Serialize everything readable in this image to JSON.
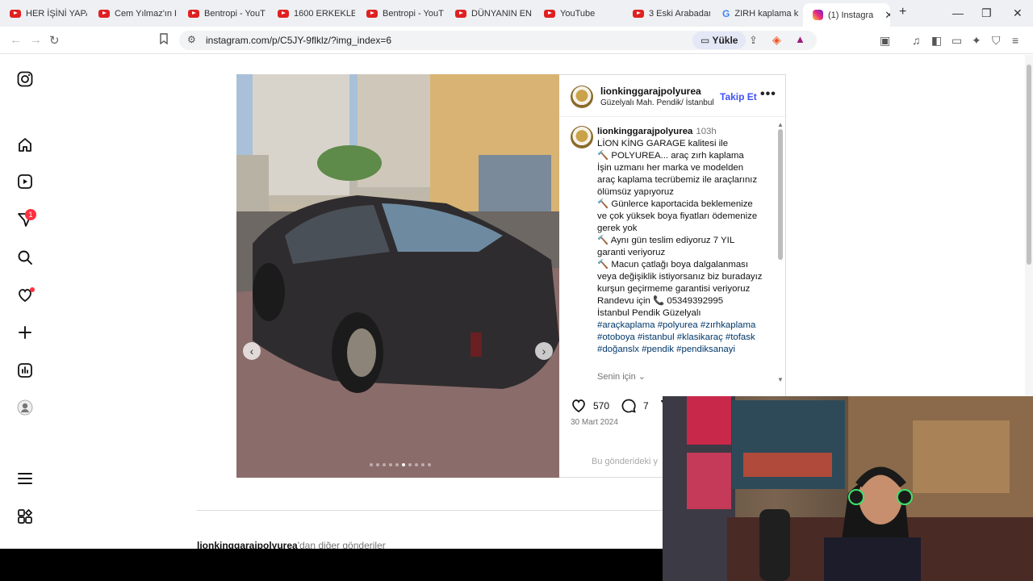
{
  "browser": {
    "tabs": [
      {
        "title": "HER İŞİNİ YAPA",
        "icon": "youtube-icon"
      },
      {
        "title": "Cem Yılmaz'ın K",
        "icon": "youtube-icon"
      },
      {
        "title": "Bentropi - YouT",
        "icon": "youtube-icon"
      },
      {
        "title": "1600 ERKEKLE İ",
        "icon": "youtube-icon"
      },
      {
        "title": "Bentropi - YouT",
        "icon": "youtube-icon"
      },
      {
        "title": "DÜNYANIN EN",
        "icon": "youtube-icon"
      },
      {
        "title": "YouTube",
        "icon": "youtube-icon"
      },
      {
        "title": "3 Eski Arabadan",
        "icon": "youtube-icon"
      },
      {
        "title": "ZIRH kaplama k",
        "icon": "google-icon"
      },
      {
        "title": "(1) Instagra",
        "icon": "instagram-icon"
      }
    ],
    "url": "instagram.com/p/C5JY-9flklz/?img_index=6",
    "upload_label": "Yükle"
  },
  "sidebar": {
    "notifications_badge": "1"
  },
  "post": {
    "username": "lionkinggarajpolyurea",
    "location": "Güzelyalı Mah. Pendik/ İstanbul",
    "follow_label": "Takip Et",
    "more_label": "•••",
    "time": "103h",
    "caption_lines": [
      "LİON KİNG GARAGE kalitesi ile",
      "🔨 POLYUREA... araç zırh kaplama",
      "İşin uzmanı her marka ve modelden",
      "araç kaplama  tecrübemiz ile araçlarınız",
      "ölümsüz yapıyoruz",
      "🔨 Günlerce kaportacida beklemenize",
      "ve çok yüksek boya fiyatları ödemenize",
      "gerek yok",
      "🔨 Aynı gün teslim ediyoruz 7 YIL",
      "garanti veriyoruz",
      "🔨 Macun çatlağı boya dalgalanması",
      "veya değişiklik istiyorsanız biz buradayız",
      "kurşun geçirmeme garantisi veriyoruz",
      "Randevu için 📞 05349392995",
      "İstanbul Pendik Güzelyalı"
    ],
    "hashtag_lines": [
      "#araçkaplama #polyurea #zırhkaplama",
      "#otoboya #istanbul #klasikaraç #tofask",
      "#doğanslx #pendik #pendiksanayi"
    ],
    "for_you_label": "Senin için",
    "likes": "570",
    "comments": "7",
    "date": "30 Mart 2024",
    "add_comment_placeholder": "Bu gönderideki y",
    "carousel_total": 10,
    "carousel_index": 6
  },
  "more_posts": {
    "username": "lionkinggarajpolyurea",
    "suffix": "'dan diğer gönderiler"
  },
  "colors": {
    "accent": "#4150f7",
    "badge": "#ff3040",
    "hashtag": "#00376b"
  }
}
